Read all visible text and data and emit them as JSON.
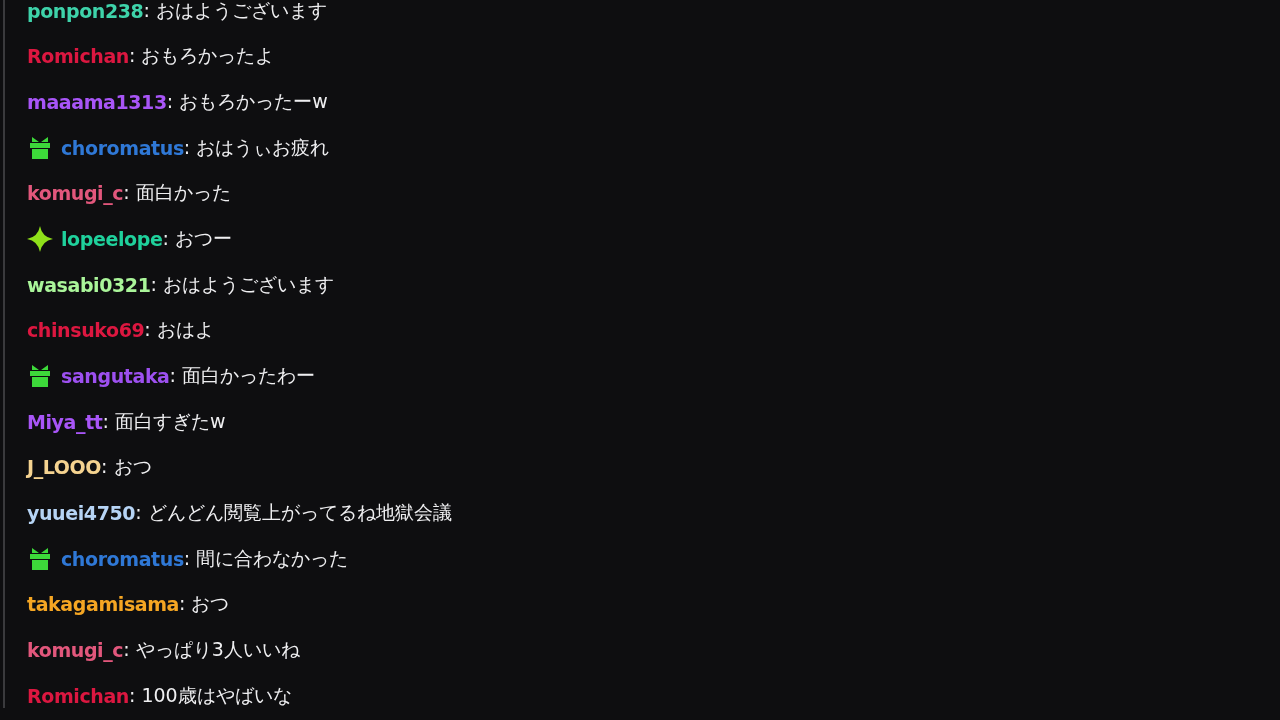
{
  "chat": {
    "messages": [
      {
        "kind": "plain",
        "user": "ponpon238",
        "color": "#3ed3aa",
        "text": ": おはようございます"
      },
      {
        "kind": "plain",
        "user": "Romichan",
        "color": "#dc1740",
        "text": ": おもろかったよ"
      },
      {
        "kind": "plain",
        "user": "maaama1313",
        "color": "#a855f7",
        "text": ": おもろかったーw"
      },
      {
        "kind": "gift",
        "user": "choromatus",
        "color": "#2f78d6",
        "text": ": おはうぃお疲れ"
      },
      {
        "kind": "plain",
        "user": "komugi_c",
        "color": "#e2577c",
        "text": ": 面白かった"
      },
      {
        "kind": "sparkle",
        "user": "lopeelope",
        "color": "#1fd19c",
        "text": ": おつー"
      },
      {
        "kind": "plain",
        "user": "wasabi0321",
        "color": "#aaf59a",
        "text": ": おはようございます"
      },
      {
        "kind": "plain",
        "user": "chinsuko69",
        "color": "#dc1740",
        "text": ": おはよ"
      },
      {
        "kind": "gift",
        "user": "sangutaka",
        "color": "#9d50f0",
        "text": ": 面白かったわー"
      },
      {
        "kind": "plain",
        "user": "Miya_tt",
        "color": "#a855f7",
        "text": ": 面白すぎたw"
      },
      {
        "kind": "plain",
        "user": "J_LOOO",
        "color": "#f5d390",
        "text": ": おつ"
      },
      {
        "kind": "plain",
        "user": "yuuei4750",
        "color": "#b6d4f5",
        "text": ": どんどん閲覧上がってるね地獄会議"
      },
      {
        "kind": "gift",
        "user": "choromatus",
        "color": "#2f78d6",
        "text": ": 間に合わなかった"
      },
      {
        "kind": "plain",
        "user": "takagamisama",
        "color": "#f5a623",
        "text": ": おつ"
      },
      {
        "kind": "plain",
        "user": "komugi_c",
        "color": "#e2577c",
        "text": ": やっぱり3人いいね"
      },
      {
        "kind": "plain",
        "user": "Romichan",
        "color": "#dc1740",
        "text": ": 100歳はやばいな"
      }
    ]
  }
}
